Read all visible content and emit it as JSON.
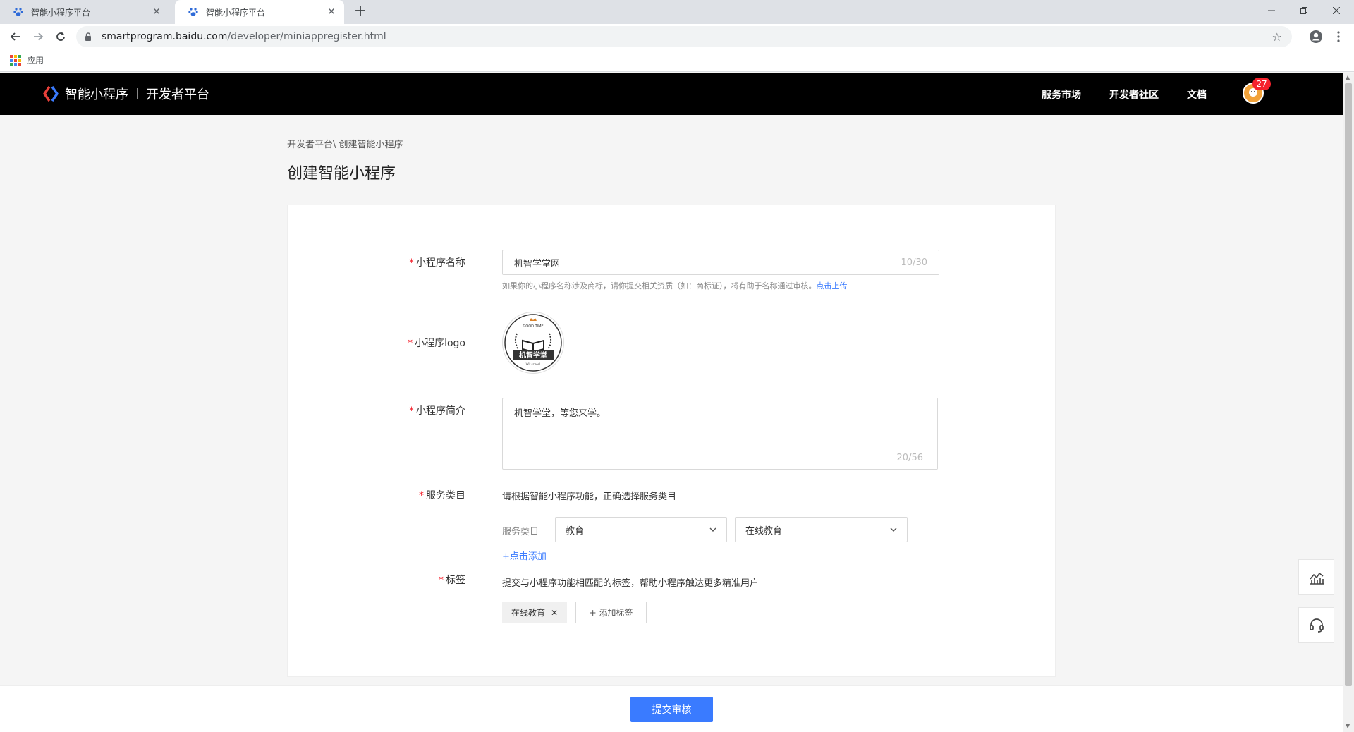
{
  "browser": {
    "tabs": [
      {
        "title": "智能小程序平台",
        "active": false
      },
      {
        "title": "智能小程序平台",
        "active": true
      }
    ],
    "url_host": "smartprogram.baidu.com",
    "url_path": "/developer/miniappregister.html",
    "bookmarks": {
      "apps_label": "应用"
    }
  },
  "header": {
    "brand": "智能小程序",
    "sub_brand": "开发者平台",
    "nav": [
      "服务市场",
      "开发者社区",
      "文档"
    ],
    "notification_count": "27"
  },
  "breadcrumb": "开发者平台\\ 创建智能小程序",
  "page_title": "创建智能小程序",
  "form": {
    "name": {
      "required_mark": "*",
      "label": "小程序名称",
      "value": "机智学堂网",
      "count": "10/30",
      "hint": "如果你的小程序名称涉及商标，请你提交相关资质（如：商标证），将有助于名称通过审核。",
      "hint_link": "点击上传"
    },
    "logo": {
      "required_mark": "*",
      "label": "小程序logo",
      "image_text": "机智学堂",
      "image_sub": "Wit school",
      "image_top": "GOOD TIME"
    },
    "intro": {
      "required_mark": "*",
      "label": "小程序简介",
      "value": "机智学堂，等您来学。",
      "count": "20/56"
    },
    "category": {
      "required_mark": "*",
      "label": "服务类目",
      "desc": "请根据智能小程序功能，正确选择服务类目",
      "sub_label": "服务类目",
      "primary": "教育",
      "secondary": "在线教育",
      "add_link": "+点击添加"
    },
    "tags": {
      "required_mark": "*",
      "label": "标签",
      "desc": "提交与小程序功能相匹配的标签，帮助小程序触达更多精准用户",
      "items": [
        "在线教育"
      ],
      "add_label": "+ 添加标签"
    }
  },
  "submit_label": "提交审核",
  "colors": {
    "accent": "#3a7bff",
    "header_bg": "#000000",
    "required": "#f5222d"
  }
}
